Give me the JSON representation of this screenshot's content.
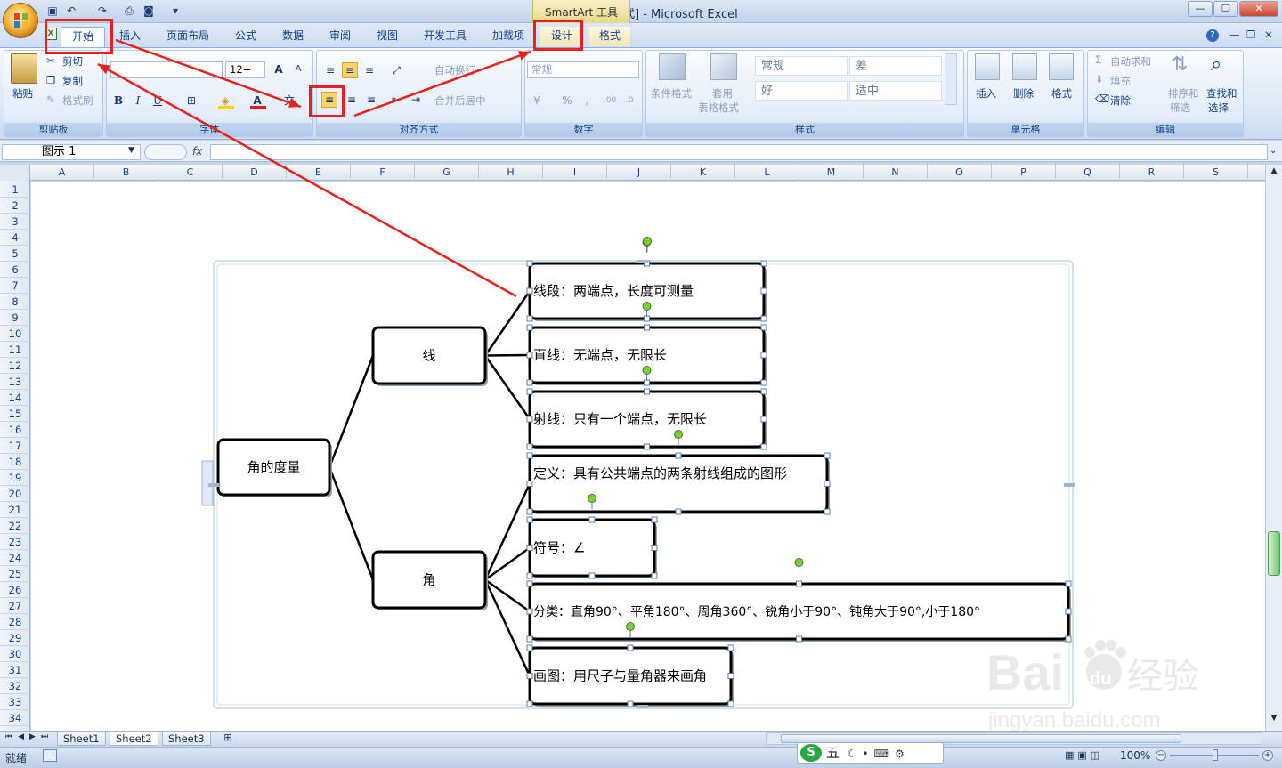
{
  "window": {
    "title": "Book1  [兼容模式] - Microsoft Excel",
    "context_tool": "SmartArt 工具"
  },
  "tabs": [
    "开始",
    "插入",
    "页面布局",
    "公式",
    "数据",
    "审阅",
    "视图",
    "开发工具",
    "加载项",
    "设计",
    "格式"
  ],
  "ribbon": {
    "clipboard": {
      "paste": "粘贴",
      "cut": "剪切",
      "copy": "复制",
      "format_painter": "格式刷",
      "label": "剪贴板"
    },
    "font": {
      "size": "12+",
      "label": "字体",
      "bold": "B",
      "italic": "I",
      "underline": "U",
      "grow": "A",
      "shrink": "A"
    },
    "alignment": {
      "wrap": "自动换行",
      "merge": "合并后居中",
      "label": "对齐方式"
    },
    "number": {
      "format": "常规",
      "percent": "%",
      "label": "数字"
    },
    "styles": {
      "conditional": "条件格式",
      "table_format": "套用",
      "table_format2": "表格格式",
      "cells": [
        "常规",
        "差",
        "好",
        "适中"
      ],
      "label": "样式"
    },
    "cells": {
      "insert": "插入",
      "delete": "删除",
      "format": "格式",
      "label": "单元格"
    },
    "editing": {
      "autosum": "自动求和",
      "fill": "填充",
      "clear": "清除",
      "sort": "排序和",
      "sort2": "筛选",
      "find": "查找和",
      "find2": "选择",
      "label": "编辑"
    }
  },
  "formula_bar": {
    "name_box": "图示 1",
    "fx": "fx"
  },
  "columns": [
    "A",
    "B",
    "C",
    "D",
    "E",
    "F",
    "G",
    "H",
    "I",
    "J",
    "K",
    "L",
    "M",
    "N",
    "O",
    "P",
    "Q",
    "R",
    "S"
  ],
  "rows": [
    "1",
    "2",
    "3",
    "4",
    "5",
    "6",
    "7",
    "8",
    "9",
    "10",
    "11",
    "12",
    "13",
    "14",
    "15",
    "16",
    "17",
    "18",
    "19",
    "20",
    "21",
    "22",
    "23",
    "24",
    "25",
    "26",
    "27",
    "28",
    "29",
    "30",
    "31",
    "32",
    "33",
    "34"
  ],
  "diagram": {
    "root": "角的度量",
    "branches": [
      {
        "label": "线",
        "children": [
          "线段：两端点，长度可测量",
          "直线：无端点，无限长",
          "射线：只有一个端点，无限长"
        ]
      },
      {
        "label": "角",
        "children": [
          "定义：具有公共端点的两条射线组成的图形",
          "符号：∠",
          "分类：直角90°、平角180°、周角360°、锐角小于90°、钝角大于90°,小于180°",
          "画图：用尺子与量角器来画角"
        ]
      }
    ]
  },
  "sheets": [
    "Sheet1",
    "Sheet2",
    "Sheet3"
  ],
  "status": {
    "ready": "就绪",
    "zoom": "100%",
    "ime": "五"
  },
  "watermark": {
    "brand": "Bai",
    "brand2": "du",
    "cn": "经验",
    "url": "jingyan.baidu.com"
  },
  "colors": {
    "highlight": "#e8211c",
    "ribbon_text": "#15428b",
    "node_handle": "#7ccf3c"
  }
}
